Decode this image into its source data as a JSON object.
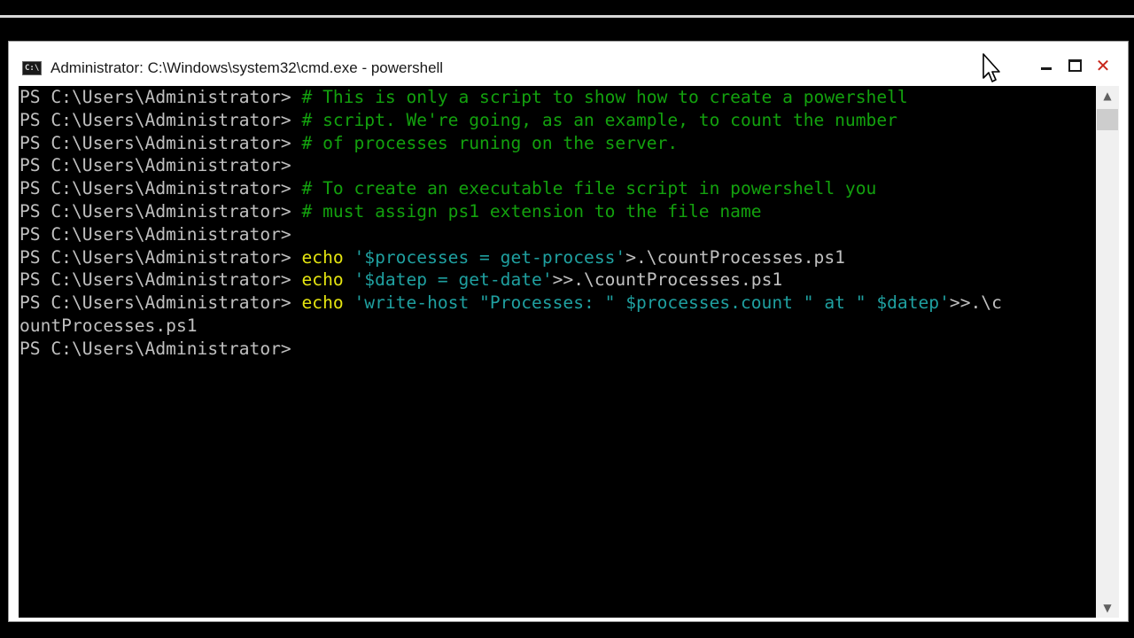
{
  "window": {
    "title": "Administrator: C:\\Windows\\system32\\cmd.exe - powershell",
    "icon_text": "C:\\",
    "close_glyph": "✕"
  },
  "scrollbar": {
    "up_glyph": "▲",
    "down_glyph": "▼"
  },
  "console": {
    "prompt": "PS C:\\Users\\Administrator> ",
    "lines": [
      [
        {
          "t": "PS C:\\Users\\Administrator> ",
          "c": "prompt"
        },
        {
          "t": "# This is only a script to show how to create a powershell",
          "c": "comment"
        }
      ],
      [
        {
          "t": "PS C:\\Users\\Administrator> ",
          "c": "prompt"
        },
        {
          "t": "# script. We're going, as an example, to count the number",
          "c": "comment"
        }
      ],
      [
        {
          "t": "PS C:\\Users\\Administrator> ",
          "c": "prompt"
        },
        {
          "t": "# of processes runing on the server.",
          "c": "comment"
        }
      ],
      [
        {
          "t": "PS C:\\Users\\Administrator>",
          "c": "prompt"
        }
      ],
      [
        {
          "t": "PS C:\\Users\\Administrator> ",
          "c": "prompt"
        },
        {
          "t": "# To create an executable file script in powershell you",
          "c": "comment"
        }
      ],
      [
        {
          "t": "PS C:\\Users\\Administrator> ",
          "c": "prompt"
        },
        {
          "t": "# must assign ps1 extension to the file name",
          "c": "comment"
        }
      ],
      [
        {
          "t": "PS C:\\Users\\Administrator>",
          "c": "prompt"
        }
      ],
      [
        {
          "t": "PS C:\\Users\\Administrator> ",
          "c": "prompt"
        },
        {
          "t": "echo",
          "c": "cmd"
        },
        {
          "t": " ",
          "c": "plain"
        },
        {
          "t": "'$processes = get-process'",
          "c": "str"
        },
        {
          "t": ">.\\countProcesses.ps1",
          "c": "plain"
        }
      ],
      [
        {
          "t": "PS C:\\Users\\Administrator> ",
          "c": "prompt"
        },
        {
          "t": "echo",
          "c": "cmd"
        },
        {
          "t": " ",
          "c": "plain"
        },
        {
          "t": "'$datep = get-date'",
          "c": "str"
        },
        {
          "t": ">>.\\countProcesses.ps1",
          "c": "plain"
        }
      ],
      [
        {
          "t": "PS C:\\Users\\Administrator> ",
          "c": "prompt"
        },
        {
          "t": "echo",
          "c": "cmd"
        },
        {
          "t": " ",
          "c": "plain"
        },
        {
          "t": "'write-host \"Processes: \" $processes.count \" at \" $datep'",
          "c": "str"
        },
        {
          "t": ">>.\\c",
          "c": "plain"
        }
      ],
      [
        {
          "t": "ountProcesses.ps1",
          "c": "plain"
        }
      ],
      [
        {
          "t": "PS C:\\Users\\Administrator>",
          "c": "prompt"
        }
      ]
    ]
  },
  "colors": {
    "prompt": "#c0c0c0",
    "comment": "#13a10e",
    "cmd": "#e5e510",
    "str": "#1fa0a0",
    "plain": "#c0c0c0",
    "background": "#000000"
  }
}
